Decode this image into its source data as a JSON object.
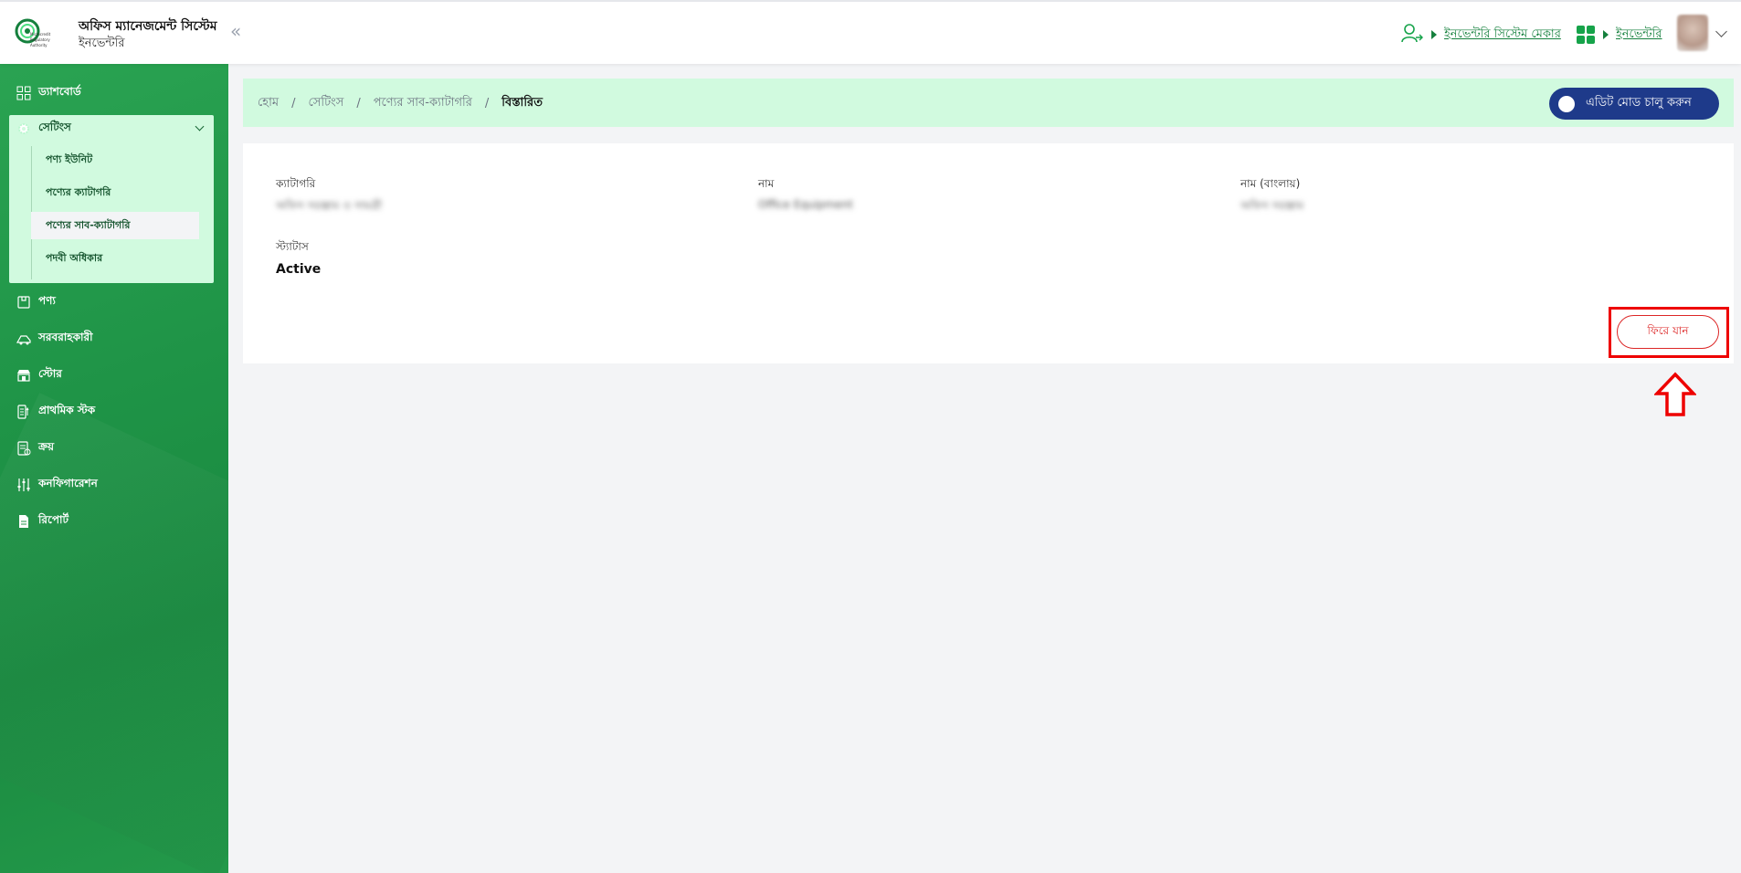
{
  "header": {
    "logo_text": "Microcredit Regulatory Authority",
    "title": "অফিস ম্যানেজমেন্ট সিস্টেম",
    "subtitle": "ইনভেন্টরি",
    "collapse_symbol": "«",
    "role_link": "ইনভেন্টরি সিস্টেম মেকার",
    "module_link": "ইনভেন্টরি"
  },
  "sidebar": {
    "items": [
      {
        "label": "ড্যাশবোর্ড",
        "icon": "grid-icon"
      },
      {
        "label": "সেটিংস",
        "icon": "gear-icon"
      },
      {
        "label": "পণ্য",
        "icon": "box-icon"
      },
      {
        "label": "সরবরাহকারী",
        "icon": "truck-icon"
      },
      {
        "label": "স্টোর",
        "icon": "store-icon"
      },
      {
        "label": "প্রাথমিক স্টক",
        "icon": "stock-icon"
      },
      {
        "label": "ক্রয়",
        "icon": "purchase-icon"
      },
      {
        "label": "কনফিগারেশন",
        "icon": "sliders-icon"
      },
      {
        "label": "রিপোর্ট",
        "icon": "report-icon"
      }
    ],
    "settings_sub": [
      {
        "label": "পণ্য ইউনিট"
      },
      {
        "label": "পণ্যের ক্যাটাগরি"
      },
      {
        "label": "পণ্যের সাব-ক্যাটাগরি"
      },
      {
        "label": "পদবী অধিকার"
      }
    ]
  },
  "breadcrumb": {
    "items": [
      "হোম",
      "সেটিংস",
      "পণ্যের সাব-ক্যাটাগরি",
      "বিস্তারিত"
    ],
    "separator": "/"
  },
  "edit_toggle": {
    "label": "এডিট মোড চালু করুন"
  },
  "details": {
    "category_label": "ক্যাটাগরি",
    "category_value": "অফিস সরঞ্জাম ও সামগ্রী",
    "name_label": "নাম",
    "name_value": "Office Equipment",
    "name_bn_label": "নাম (বাংলায়)",
    "name_bn_value": "অফিস সরঞ্জাম",
    "status_label": "স্ট্যাটাস",
    "status_value": "Active"
  },
  "back_button": {
    "label": "ফিরে যান"
  },
  "colors": {
    "sidebar_green": "#1f9447",
    "breadcrumb_bg": "#d1fadf",
    "toggle_bg": "#1e3a8a",
    "back_red": "#dc2626",
    "highlight_red": "#ee0000"
  }
}
